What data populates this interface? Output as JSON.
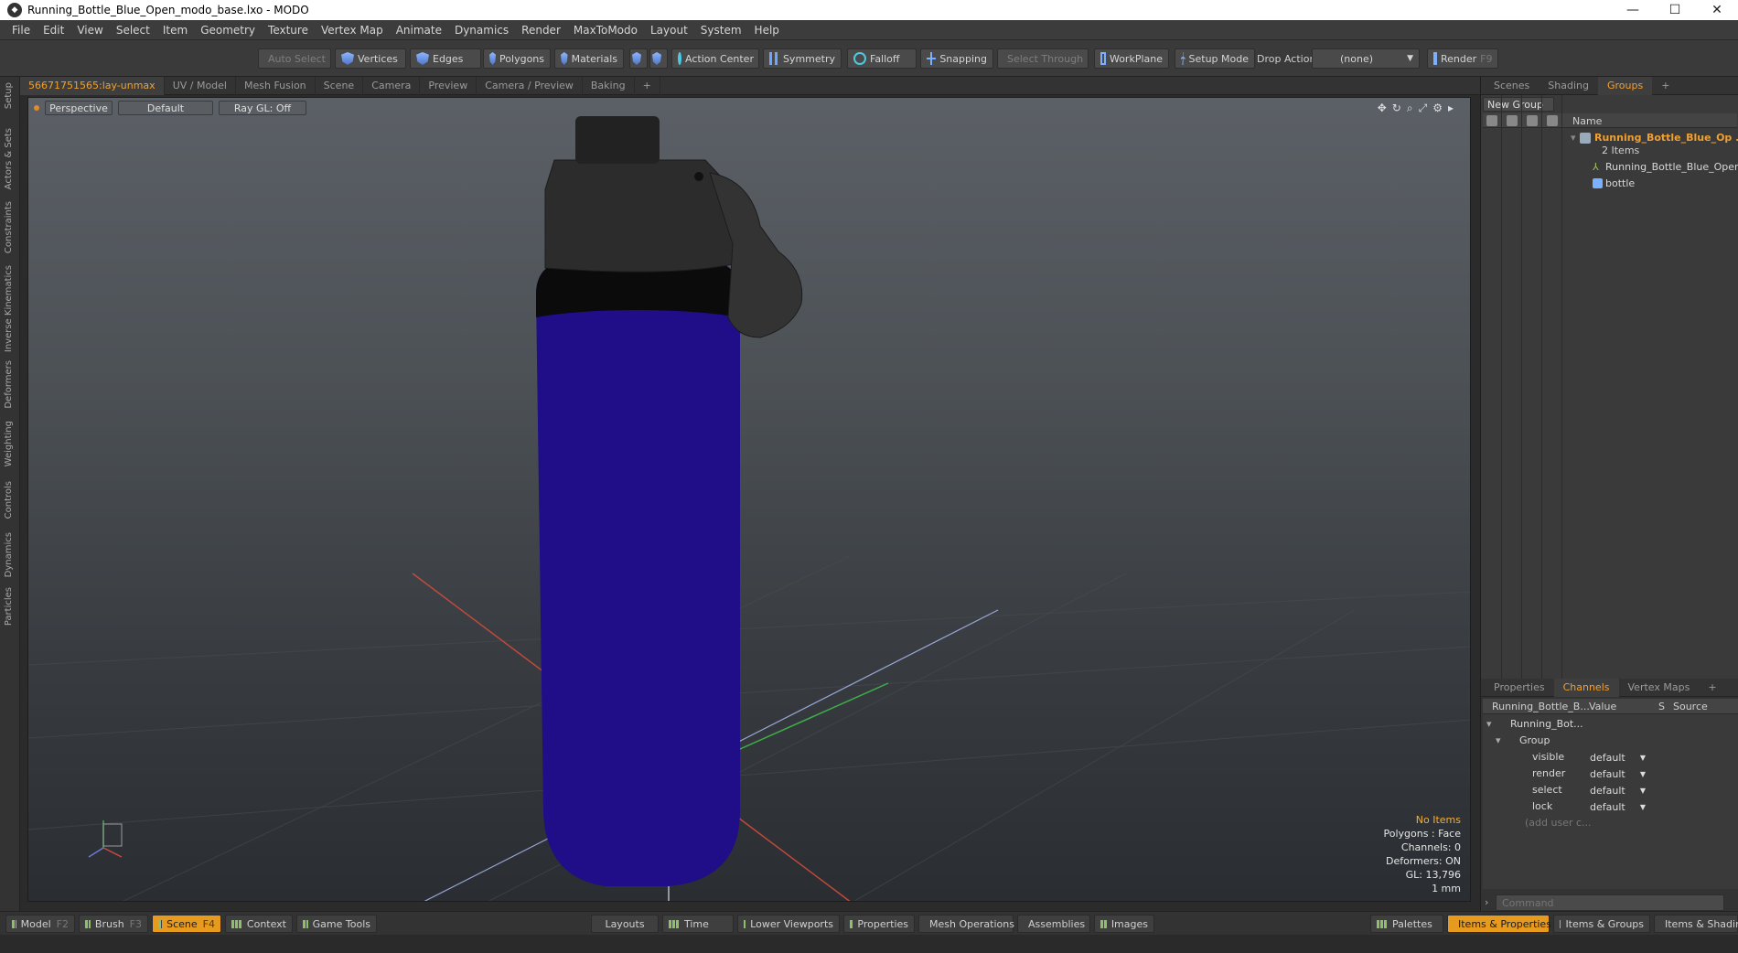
{
  "window": {
    "title": "Running_Bottle_Blue_Open_modo_base.lxo - MODO"
  },
  "menu": [
    "File",
    "Edit",
    "View",
    "Select",
    "Item",
    "Geometry",
    "Texture",
    "Vertex Map",
    "Animate",
    "Dynamics",
    "Render",
    "MaxToModo",
    "Layout",
    "System",
    "Help"
  ],
  "toolbar": {
    "auto_select": "Auto Select",
    "vertices": "Vertices",
    "edges": "Edges",
    "polygons": "Polygons",
    "materials": "Materials",
    "action_center": "Action Center",
    "symmetry": "Symmetry",
    "falloff": "Falloff",
    "snapping": "Snapping",
    "select_through": "Select Through",
    "workplane": "WorkPlane",
    "setup_mode": "Setup Mode",
    "drop_action": "Drop Action",
    "drop_action_value": "(none)",
    "render": "Render",
    "render_key": "F9"
  },
  "left_tabs": [
    "Setup",
    "Actors & Sets",
    "Constraints",
    "Inverse Kinematics",
    "Deformers",
    "Weighting",
    "Controls",
    "Dynamics",
    "Particles"
  ],
  "viewport_tabs": [
    "56671751565:lay-unmax",
    "UV / Model",
    "Mesh Fusion",
    "Scene",
    "Camera",
    "Preview",
    "Camera / Preview",
    "Baking",
    "+"
  ],
  "viewport": {
    "perspective": "Perspective",
    "shading": "Default",
    "raygl": "Ray GL: Off",
    "stats": {
      "items": "No Items",
      "polygons": "Polygons : Face",
      "channels": "Channels: 0",
      "deformers": "Deformers: ON",
      "gl": "GL: 13,796",
      "unit": "1 mm"
    }
  },
  "right_tabs": [
    "Scenes",
    "Shading",
    "Groups",
    "+"
  ],
  "groups": {
    "new_group": "New Group",
    "name_header": "Name",
    "group_name": "Running_Bottle_Blue_Op ...",
    "group_count": "2 Items",
    "children": [
      "Running_Bottle_Blue_Open",
      "bottle"
    ]
  },
  "channel_tabs": [
    "Properties",
    "Channels",
    "Vertex Maps",
    "+"
  ],
  "channels": {
    "head_item": "Running_Bottle_B...",
    "head_value": "Value",
    "head_s": "S",
    "head_source": "Source",
    "item": "Running_Bot...",
    "group": "Group",
    "rows": [
      {
        "key": "visible",
        "value": "default"
      },
      {
        "key": "render",
        "value": "default"
      },
      {
        "key": "select",
        "value": "default"
      },
      {
        "key": "lock",
        "value": "default"
      }
    ],
    "add_user": "(add user c..."
  },
  "command": {
    "placeholder": "Command"
  },
  "bottom": {
    "model": "Model",
    "model_key": "F2",
    "brush": "Brush",
    "brush_key": "F3",
    "scene": "Scene",
    "scene_key": "F4",
    "context": "Context",
    "game_tools": "Game Tools",
    "layouts": "Layouts",
    "time": "Time",
    "lower_viewports": "Lower Viewports",
    "properties": "Properties",
    "mesh_operations": "Mesh Operations",
    "assemblies": "Assemblies",
    "images": "Images",
    "palettes": "Palettes",
    "items_properties": "Items & Properties",
    "items_groups": "Items & Groups",
    "items_shading": "Items & Shadin"
  },
  "colors": {
    "accent": "#f0a030",
    "bottle": "#1f0e87",
    "cap": "#2c2c2c"
  }
}
